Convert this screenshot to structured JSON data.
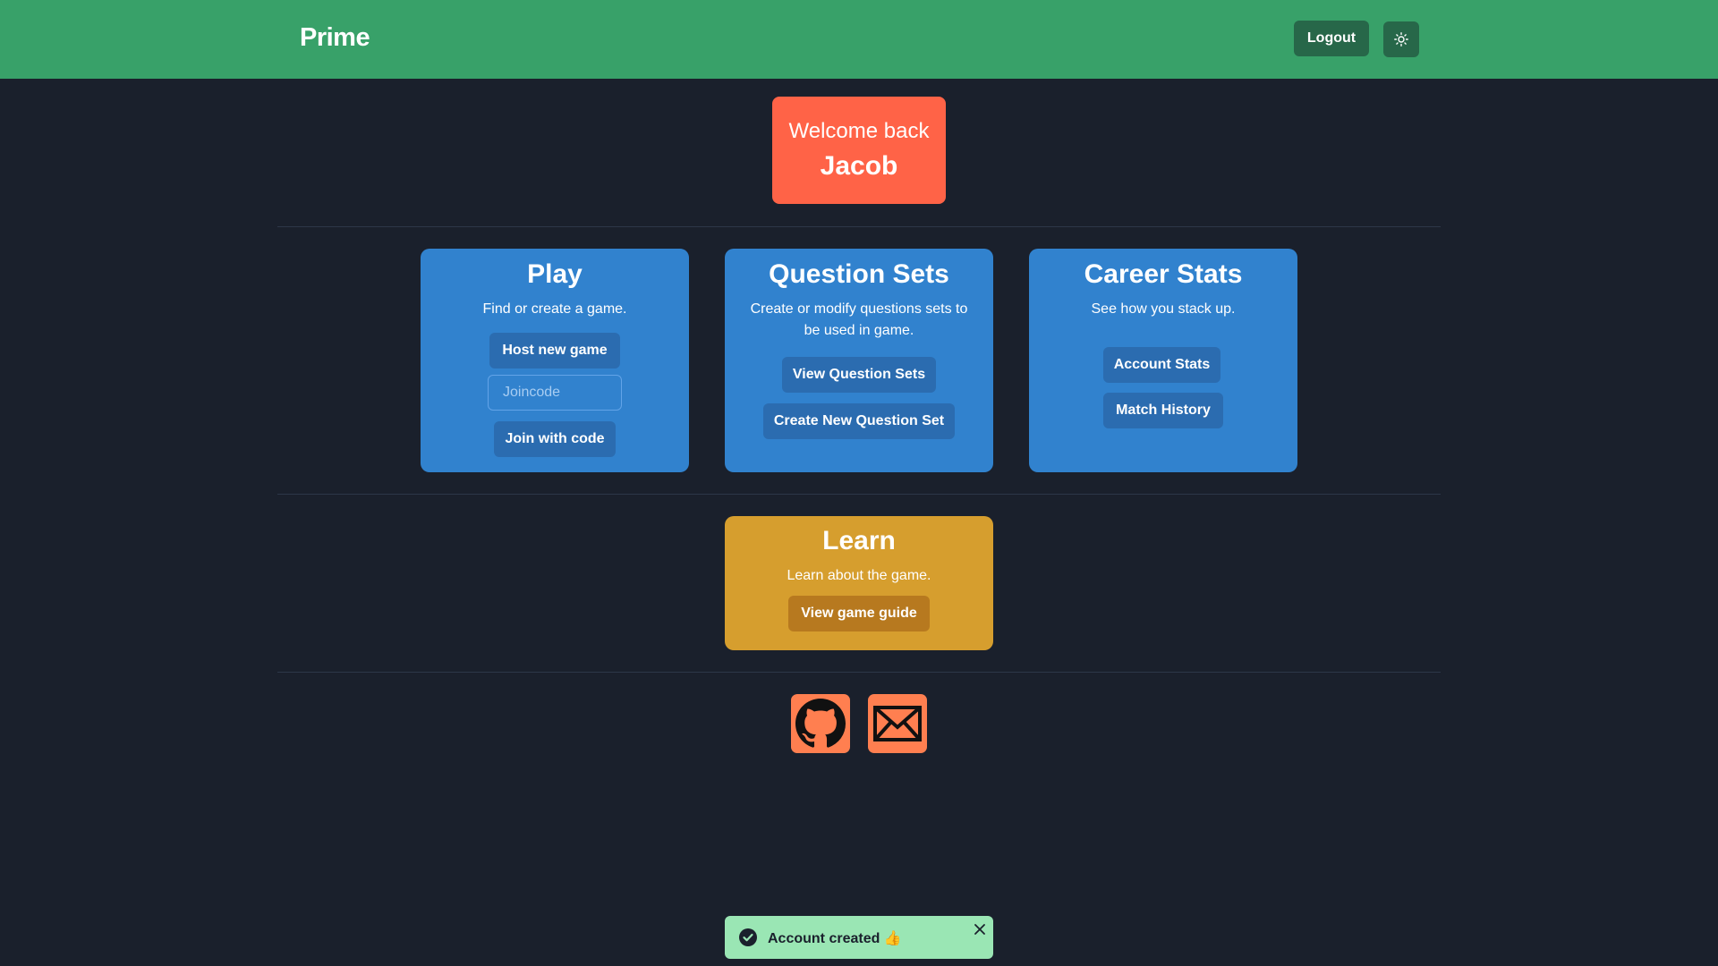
{
  "header": {
    "brand": "Prime",
    "logout_label": "Logout",
    "theme_icon": "sun-icon",
    "background_color": "#38a169"
  },
  "welcome": {
    "line1": "Welcome back",
    "name": "Jacob",
    "color": "#ff6347"
  },
  "cards": {
    "play": {
      "title": "Play",
      "description": "Find or create a game.",
      "host_label": "Host new game",
      "joincode_placeholder": "Joincode",
      "joincode_value": "",
      "join_label": "Join with code"
    },
    "question_sets": {
      "title": "Question Sets",
      "description_line1": "Create or modify questions sets to",
      "description_line2": "be used in game.",
      "view_label": "View Question Sets",
      "create_label": "Create New Question Set"
    },
    "career": {
      "title": "Career Stats",
      "description": "See how you stack up.",
      "account_label": "Account Stats",
      "history_label": "Match History"
    },
    "learn": {
      "title": "Learn",
      "description": "Learn about the game.",
      "guide_label": "View game guide"
    }
  },
  "footer": {
    "icons": [
      "github-icon",
      "mail-icon"
    ]
  },
  "toast": {
    "message": "Account created",
    "emoji": "👍",
    "status_icon": "check-circle-icon",
    "close_icon": "close-icon",
    "color": "#9ae6b4"
  }
}
